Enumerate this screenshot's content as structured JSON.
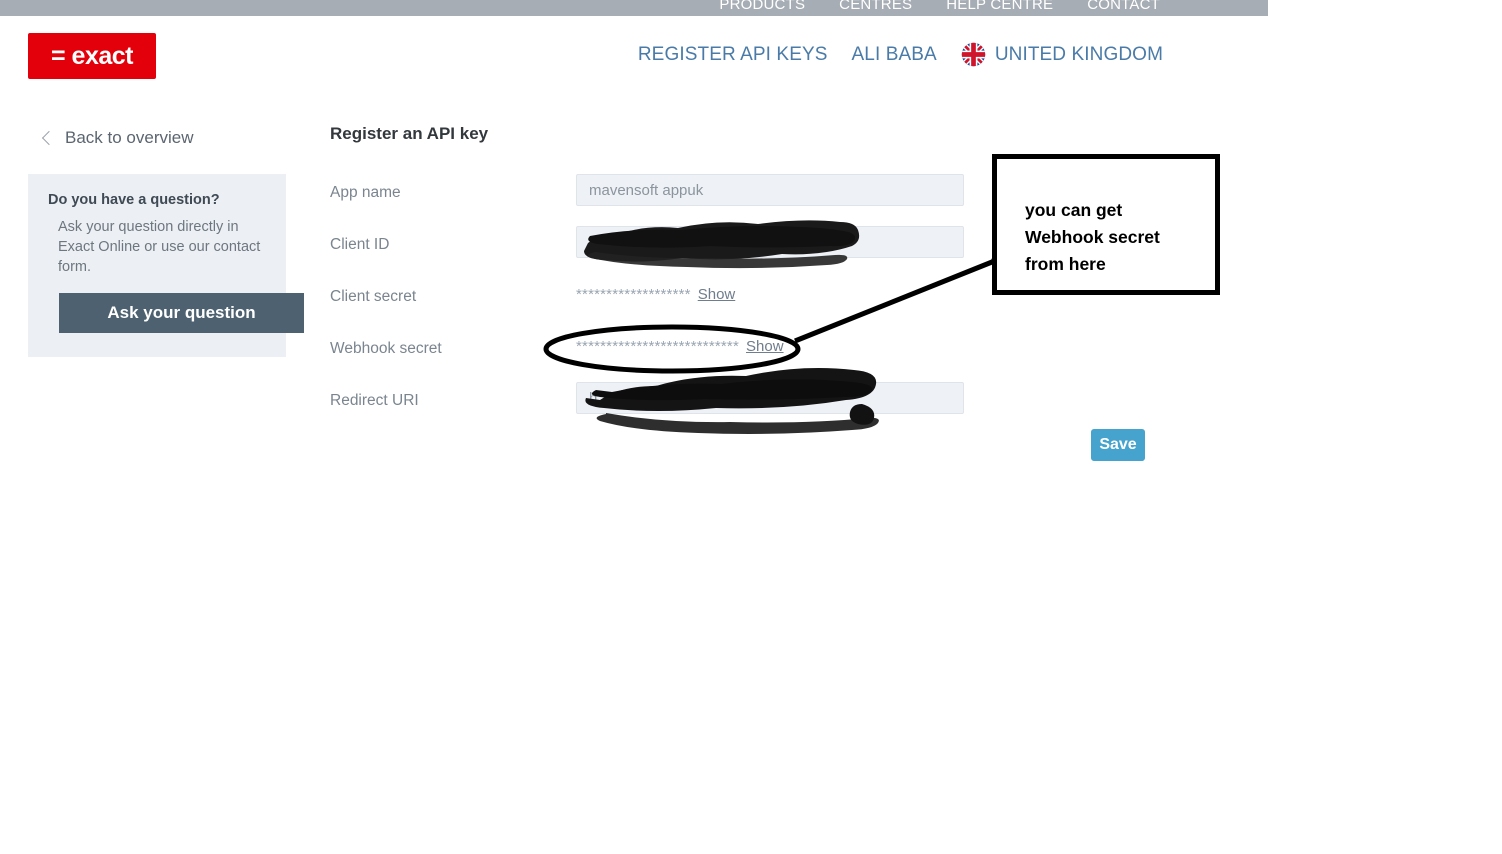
{
  "topbar": {
    "links": [
      {
        "label": "PRODUCTS"
      },
      {
        "label": "CENTRES"
      },
      {
        "label": "HELP CENTRE"
      },
      {
        "label": "CONTACT"
      }
    ],
    "bar_color": "#a6adb4"
  },
  "header": {
    "logo_text": "= exact",
    "logo_color": "#e3000b",
    "nav": [
      {
        "label": "REGISTER API KEYS"
      },
      {
        "label": "ALI BABA"
      }
    ],
    "country": {
      "label": "UNITED KINGDOM",
      "flag": "uk-flag-icon"
    },
    "nav_color": "#4a7ba8"
  },
  "sidebar": {
    "back_label": "Back to overview",
    "question_box": {
      "title": "Do you have a question?",
      "body": "Ask your question directly in Exact Online or use our contact form.",
      "button_label": "Ask your question",
      "button_color": "#4d6170",
      "background": "#eceff3"
    }
  },
  "main": {
    "page_title": "Register an API key",
    "fields": [
      {
        "label": "App name",
        "type": "input",
        "value": "mavensoft appuk",
        "redacted": false
      },
      {
        "label": "Client ID",
        "type": "input",
        "value": "",
        "redacted": true
      },
      {
        "label": "Client secret",
        "type": "masked",
        "value": "*******************",
        "show_label": "Show"
      },
      {
        "label": "Webhook secret",
        "type": "masked",
        "value": "***************************",
        "show_label": "Show"
      },
      {
        "label": "Redirect URI",
        "type": "input",
        "value": "h",
        "redacted": true
      }
    ],
    "save_label": "Save",
    "save_color": "#45a3ce"
  },
  "annotation": {
    "text_line1": "you can get",
    "text_line2": "Webhook secret",
    "text_line3": "from here",
    "color": "#000000"
  }
}
